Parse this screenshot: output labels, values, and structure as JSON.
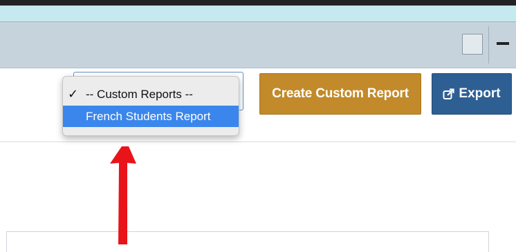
{
  "toolbar": {
    "create_custom_report_label": "Create Custom Report",
    "export_label": "Export",
    "export_icon": "external-link-icon"
  },
  "report_select": {
    "options": [
      {
        "label": "-- Custom Reports --",
        "checked": true
      },
      {
        "label": "French Students Report",
        "highlighted": true
      }
    ],
    "check_glyph": "✓"
  },
  "colors": {
    "create_button": "#c28a2a",
    "export_button": "#2d5f93",
    "highlight": "#3a86ec",
    "annotation_arrow": "#e8141a"
  }
}
